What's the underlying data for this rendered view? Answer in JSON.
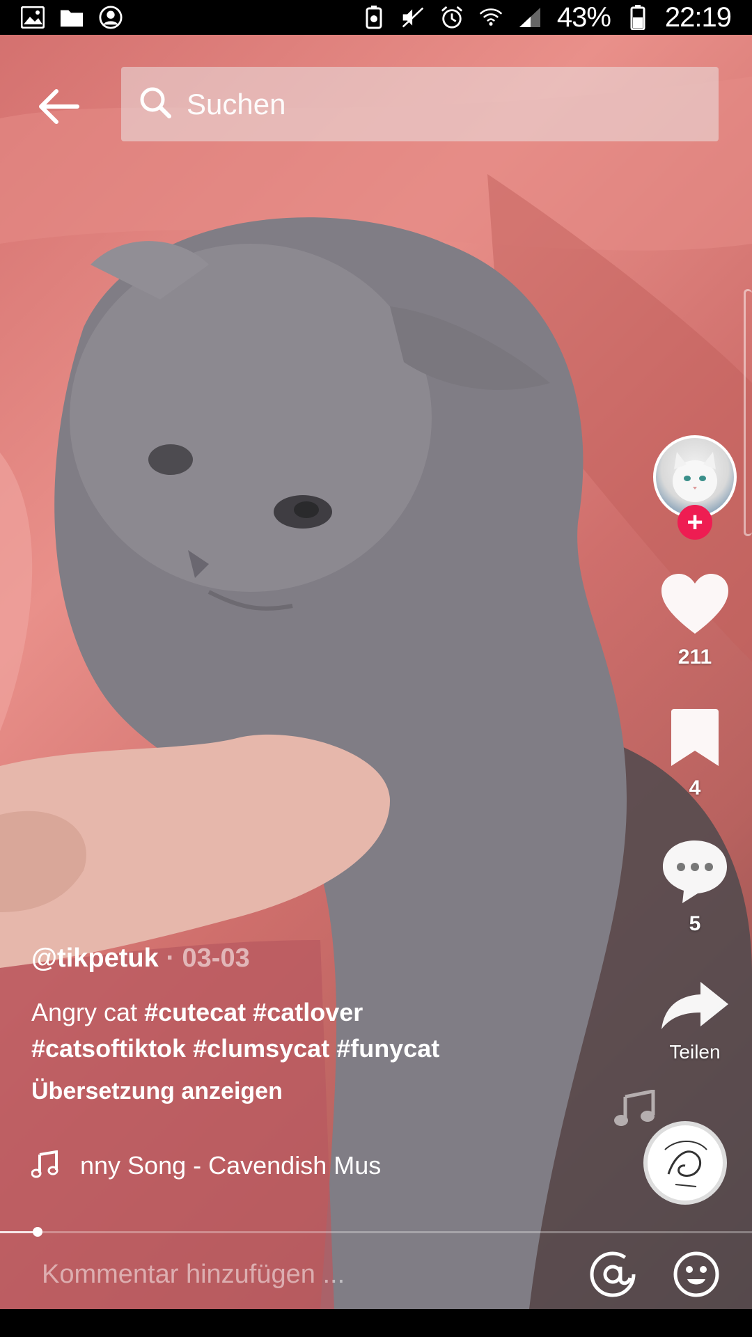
{
  "status_bar": {
    "battery": "43%",
    "time": "22:19",
    "left_icons": [
      "gallery-icon",
      "folder-icon",
      "account-icon"
    ],
    "right_icons": [
      "recycle-icon",
      "mute-icon",
      "alarm-icon",
      "wifi-icon",
      "signal-icon",
      "battery-icon"
    ]
  },
  "search": {
    "placeholder": "Suchen"
  },
  "rail": {
    "likes": "211",
    "saves": "4",
    "comments": "5",
    "share_label": "Teilen"
  },
  "video": {
    "author": "@tikpetuk",
    "separator": "·",
    "date": "03-03",
    "description_text": "Angry cat",
    "hashtags_line1": "#cutecat #catlover",
    "hashtags_line2": "#catsoftiktok #clumsycat #funycat",
    "translate_label": "Übersetzung anzeigen",
    "music": "nny Song - Cavendish Mus",
    "progress": 0.05
  },
  "comment": {
    "placeholder": "Kommentar hinzufügen ..."
  },
  "colors": {
    "accent": "#ee1d52",
    "background": "#d4716f"
  }
}
